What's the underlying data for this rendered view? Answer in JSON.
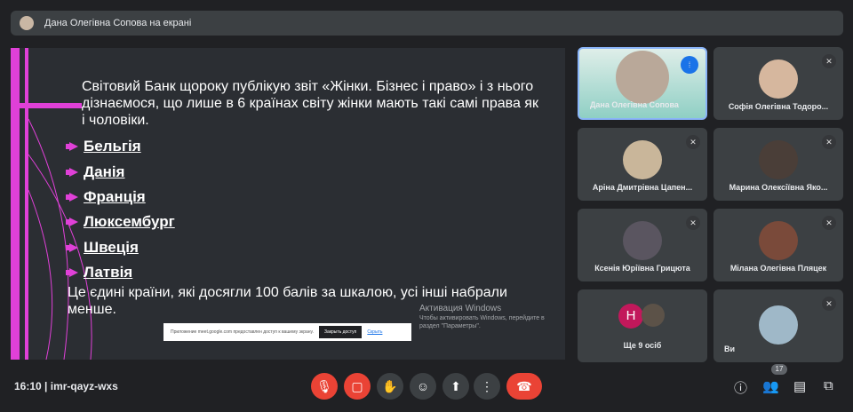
{
  "presenter_bar": {
    "label": "Дана Олегівна Сопова на екрані"
  },
  "slide": {
    "paragraph": "Світовий Банк щороку публікую звіт «Жінки. Бізнес і право» і з нього дізнаємося, що лише в 6 країнах світу жінки мають такі самі права як і чоловіки.",
    "countries": [
      "Бельгія",
      "Данія",
      "Франція",
      "Люксембург",
      "Швеція",
      "Латвія"
    ],
    "conclusion": "Це єдині країни, які досягли 100 балів за шкалою, усі інші набрали менше.",
    "accent_color": "#e040d8"
  },
  "share_notice": {
    "text": "Приложение meet.google.com предоставлен доступ к вашему экрану.",
    "stop_button": "Закрыть доступ",
    "hide_link": "Скрыть"
  },
  "windows_activation": {
    "title": "Активация Windows",
    "subtitle": "Чтобы активировать Windows, перейдите в раздел \"Параметры\"."
  },
  "participants": [
    {
      "name": "Дана Олегівна Сопова",
      "speaking": true
    },
    {
      "name": "Софія Олегівна Тодоро...",
      "muted": true
    },
    {
      "name": "Аріна Дмитрівна Цапен...",
      "muted": true
    },
    {
      "name": "Марина Олексіївна Яко...",
      "muted": true
    },
    {
      "name": "Ксенія Юріївна Грицюта",
      "muted": true
    },
    {
      "name": "Мілана Олегівна Пляцек",
      "muted": true
    },
    {
      "name": "Ще 9 осіб",
      "initial": "H"
    },
    {
      "name": "Ви",
      "muted": true
    }
  ],
  "bottom": {
    "time": "16:10",
    "separator": "|",
    "meeting_code": "imr-qayz-wxs",
    "people_count": "17"
  }
}
